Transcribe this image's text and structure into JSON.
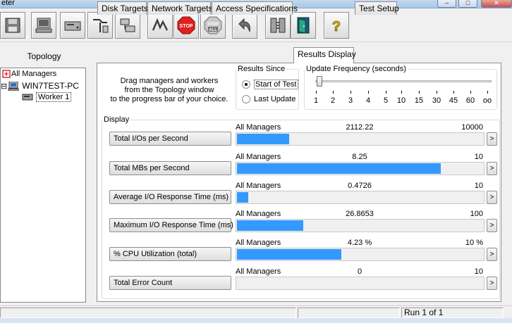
{
  "window": {
    "title": "eter",
    "min_label": "–",
    "max_label": "□",
    "close_label": "✕"
  },
  "toolbar": {
    "buttons": [
      {
        "icon": "save-icon"
      },
      {
        "icon": "display-icon"
      },
      {
        "icon": "drive-icon"
      },
      {
        "icon": "fork-icon"
      },
      {
        "icon": "network-icon"
      },
      {
        "icon": "wave-icon"
      },
      {
        "icon": "stop-icon",
        "label": "STOP"
      },
      {
        "icon": "stop-all-icon",
        "label": "STOP ALL"
      },
      {
        "icon": "undo-icon"
      },
      {
        "icon": "workers-icon"
      },
      {
        "icon": "exit-door-icon"
      },
      {
        "icon": "help-icon",
        "label": "?"
      }
    ]
  },
  "topology": {
    "header": "Topology",
    "items": [
      {
        "label": "All Managers",
        "prefix": ""
      },
      {
        "label": "WIN7TEST-PC",
        "prefix": "⊟"
      },
      {
        "label": "Worker 1",
        "prefix": ""
      }
    ]
  },
  "tabs": [
    {
      "label": "Disk Targets",
      "active": false
    },
    {
      "label": "Network Targets",
      "active": false
    },
    {
      "label": "Access Specifications",
      "active": false
    },
    {
      "label": "Results Display",
      "active": true
    },
    {
      "label": "Test Setup",
      "active": false
    }
  ],
  "instructions": {
    "line1": "Drag managers and workers",
    "line2": "from the Topology window",
    "line3": "to the progress bar of your choice."
  },
  "results_since": {
    "legend": "Results Since",
    "options": [
      {
        "label": "Start of Test",
        "selected": true
      },
      {
        "label": "Last Update",
        "selected": false
      }
    ]
  },
  "update_frequency": {
    "legend": "Update Frequency (seconds)",
    "ticks": [
      "1",
      "2",
      "3",
      "4",
      "5",
      "10",
      "15",
      "30",
      "45",
      "60",
      "oo"
    ],
    "selected_index": 0
  },
  "display": {
    "legend": "Display",
    "metrics": [
      {
        "button": "Total I/Os per Second",
        "source": "All Managers",
        "value": "2112.22",
        "max": "10000",
        "fill": 0.211
      },
      {
        "button": "Total MBs per Second",
        "source": "All Managers",
        "value": "8.25",
        "max": "10",
        "fill": 0.825
      },
      {
        "button": "Average I/O Response Time (ms)",
        "source": "All Managers",
        "value": "0.4726",
        "max": "10",
        "fill": 0.047
      },
      {
        "button": "Maximum I/O Response Time (ms)",
        "source": "All Managers",
        "value": "26.8653",
        "max": "100",
        "fill": 0.269
      },
      {
        "button": "% CPU Utilization (total)",
        "source": "All Managers",
        "value": "4.23 %",
        "max": "10 %",
        "fill": 0.423
      },
      {
        "button": "Total Error Count",
        "source": "All Managers",
        "value": "0",
        "max": "10",
        "fill": 0
      }
    ],
    "arrow_label": ">",
    "bar_color": "#3399ff"
  },
  "status": {
    "run": "Run 1 of 1"
  }
}
